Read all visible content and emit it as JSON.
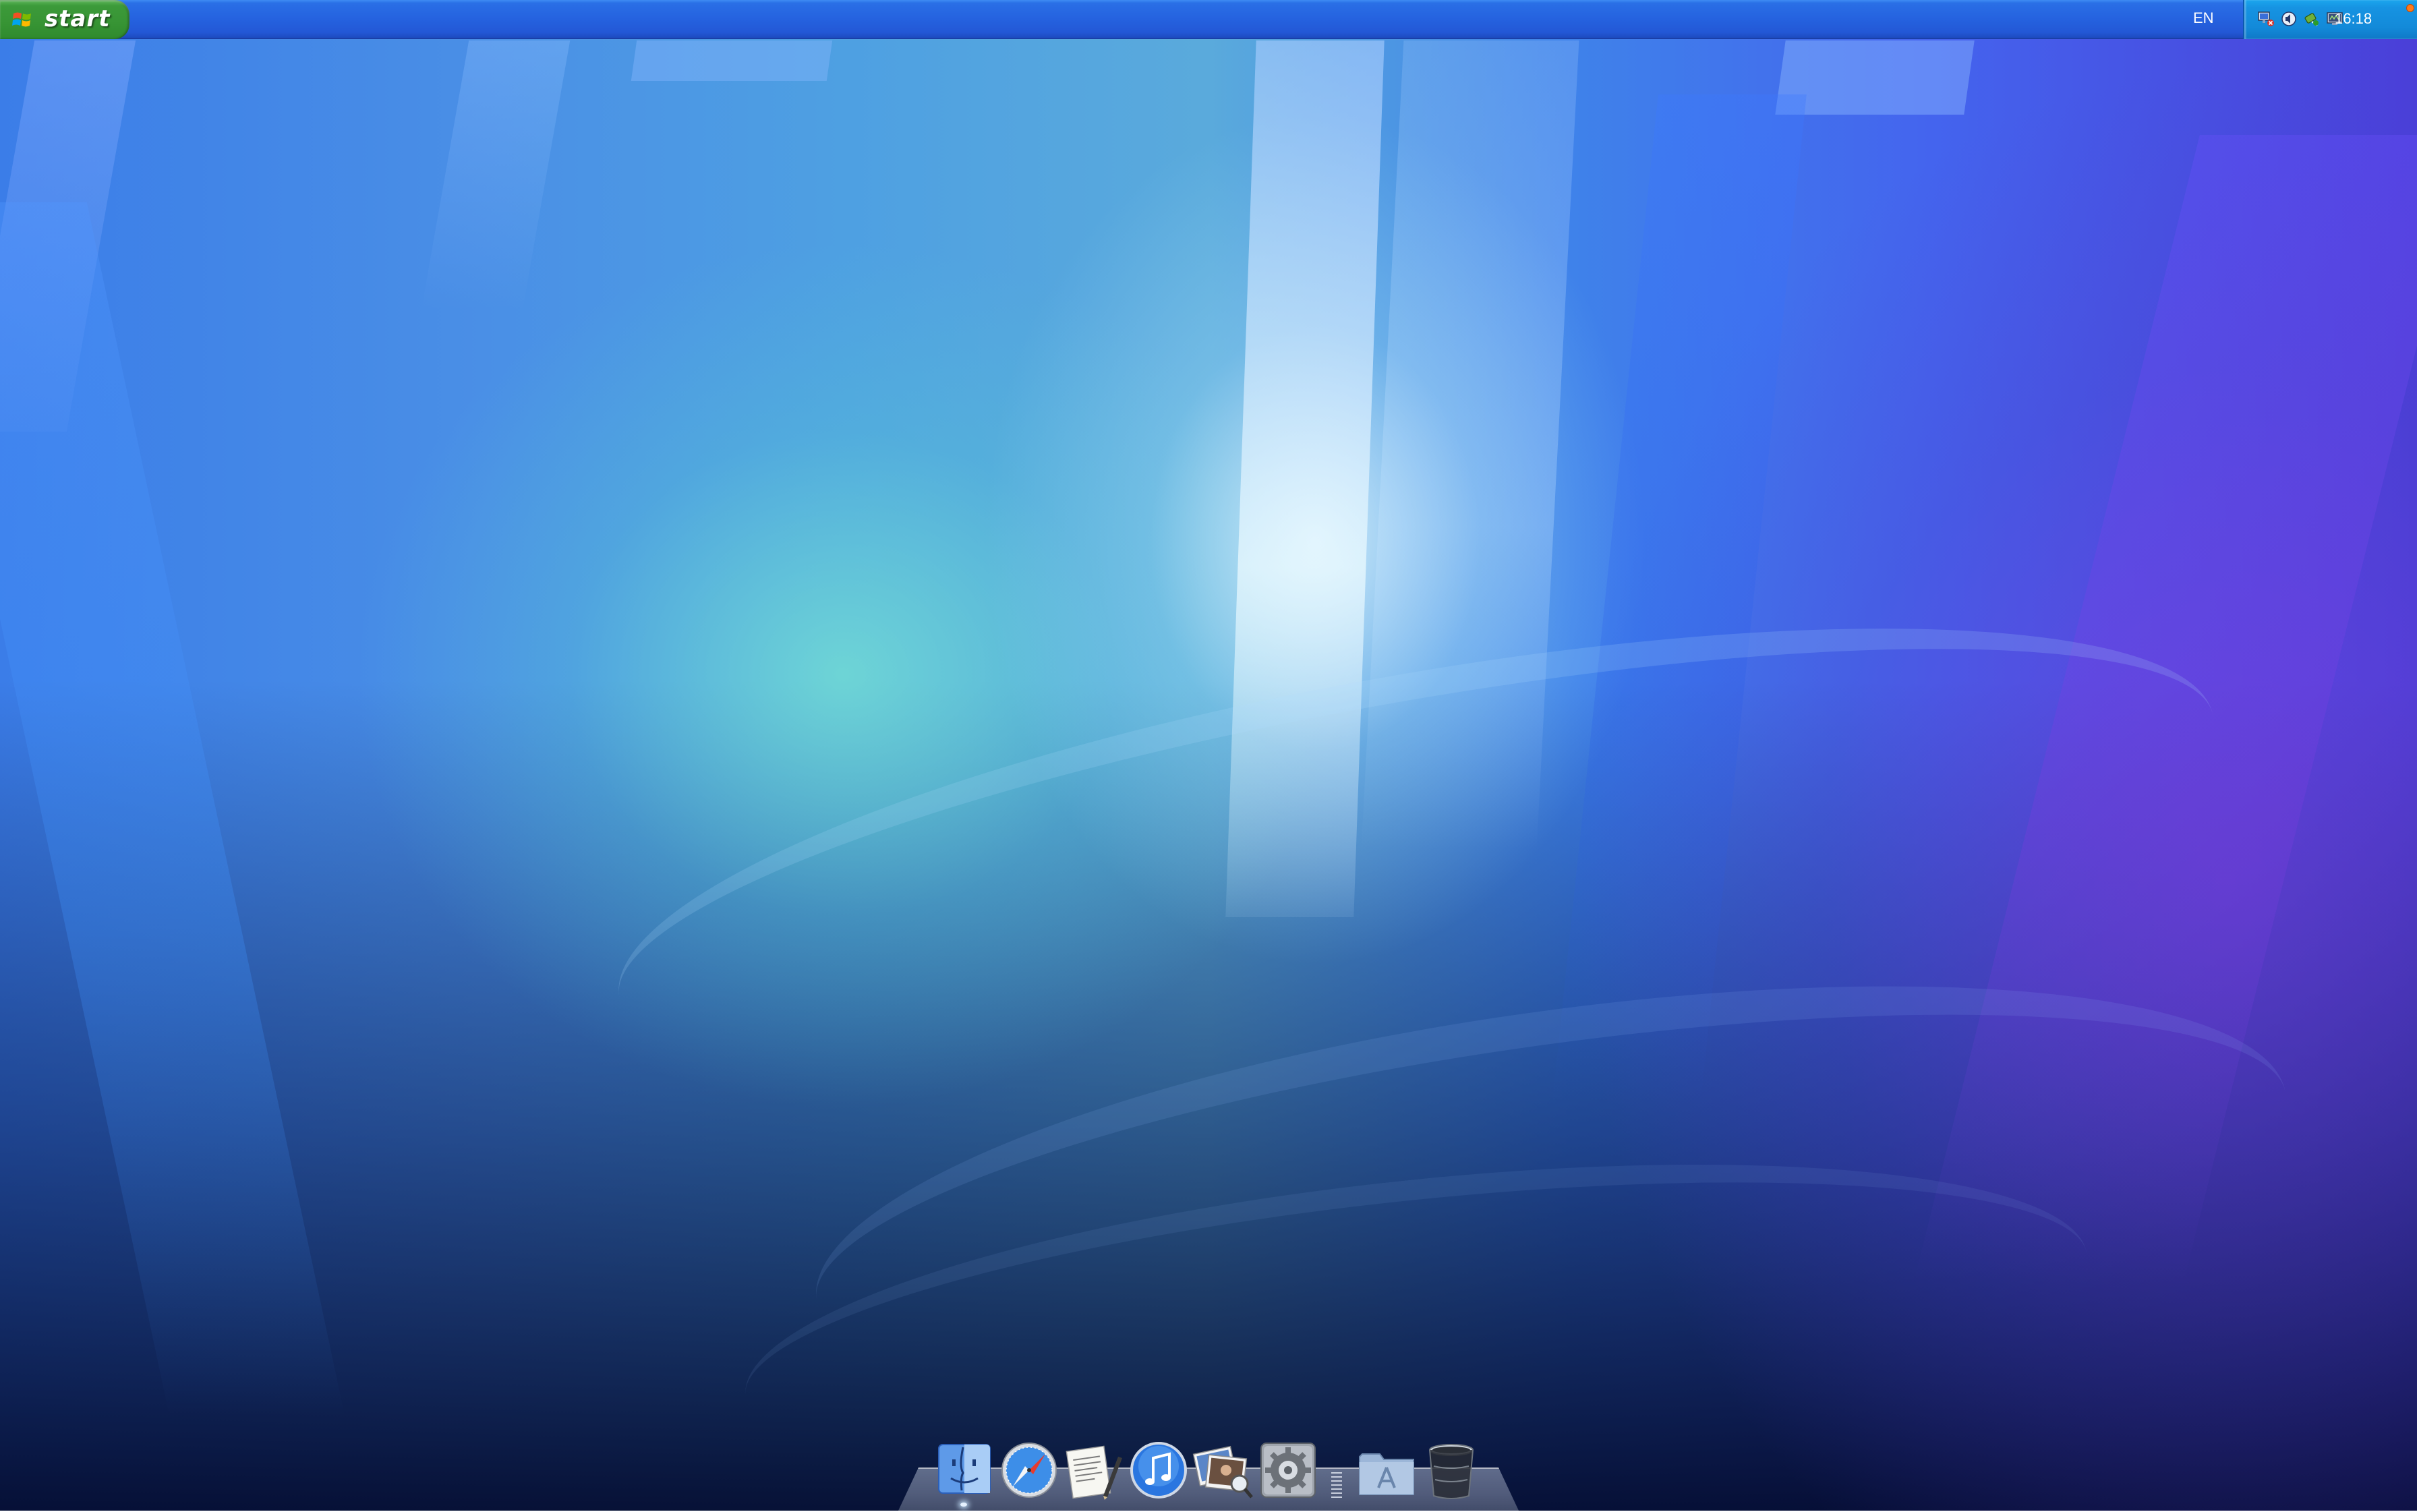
{
  "taskbar": {
    "start_label": "start",
    "language": "EN",
    "clock": "16:18",
    "tray_icons": [
      "network-icon",
      "volume-icon",
      "safely-remove-hardware-icon",
      "monitor-icon"
    ]
  },
  "dock": {
    "items": [
      {
        "name": "finder",
        "icon": "finder-icon"
      },
      {
        "name": "safari",
        "icon": "safari-compass-icon"
      },
      {
        "name": "textedit",
        "icon": "textedit-icon"
      },
      {
        "name": "itunes",
        "icon": "itunes-icon"
      },
      {
        "name": "preview",
        "icon": "preview-photos-icon"
      },
      {
        "name": "system-preferences",
        "icon": "gear-icon"
      },
      {
        "name": "applications-folder",
        "icon": "applications-folder-icon"
      },
      {
        "name": "trash",
        "icon": "trash-icon"
      }
    ]
  },
  "colors": {
    "taskbar_blue": "#2562df",
    "start_green": "#379434",
    "tray_blue": "#138ad9"
  }
}
